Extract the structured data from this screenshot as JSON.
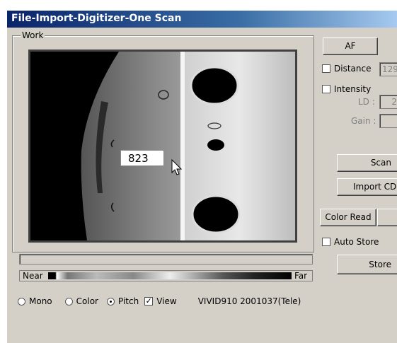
{
  "window": {
    "title": "File-Import-Digitizer-One Scan"
  },
  "work_group": {
    "label": "Work"
  },
  "display": {
    "value_readout": "823"
  },
  "scale": {
    "near_label": "Near",
    "far_label": "Far"
  },
  "modes": [
    {
      "label": "Mono",
      "selected": false
    },
    {
      "label": "Color",
      "selected": false
    },
    {
      "label": "Pitch",
      "selected": true
    }
  ],
  "view_checkbox": {
    "label": "View",
    "checked": true
  },
  "device_info": "VIVID910  2001037(Tele)",
  "right_panel": {
    "af_button": "AF",
    "distance": {
      "label": "Distance",
      "checked": false,
      "value": "129"
    },
    "intensity": {
      "label": "Intensity",
      "checked": false
    },
    "ld_label": "LD :",
    "ld_value": "2",
    "gain_label": "Gain :",
    "gain_value": "",
    "scan_button": "Scan",
    "import_button": "Import CDI",
    "color_read_button": "Color Read",
    "auto_store": {
      "label": "Auto Store",
      "checked": false
    },
    "store_button": "Store"
  }
}
